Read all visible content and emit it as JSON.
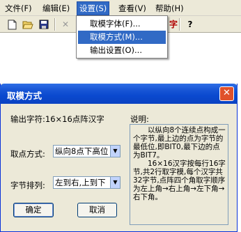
{
  "menubar": {
    "items": [
      {
        "label": "文件(F)"
      },
      {
        "label": "编辑(E)"
      },
      {
        "label": "设置(S)"
      },
      {
        "label": "查看(V)"
      },
      {
        "label": "帮助(H)"
      }
    ]
  },
  "toolbar": {
    "icons": [
      "new-icon",
      "open-icon",
      "save-icon",
      "delete-icon",
      "help-icon"
    ],
    "font_text": "字"
  },
  "settings_menu": {
    "items": [
      {
        "label": "取模字体(F)..."
      },
      {
        "label": "取模方式(M)..."
      },
      {
        "label": "输出设置(O)..."
      }
    ]
  },
  "dialog": {
    "title": "取模方式",
    "output_label": "输出字符:16×16点阵汉字",
    "scan_label": "取点方式:",
    "scan_value": "纵向8点下高位",
    "order_label": "字节排列:",
    "order_value": "左到右,上到下",
    "desc_label": "说明:",
    "description": "　　以纵向8个连续点构成一个字节,最上边的点为字节的最低位,即BIT0,最下边的点为BIT7。\n　　16×16汉字按每行16字节,共2行取字模,每个汉字共32字节,点阵四个角取字顺序为左上角→右上角→左下角→右下角。",
    "ok_label": "确定",
    "cancel_label": "取消",
    "close_glyph": "✕"
  }
}
